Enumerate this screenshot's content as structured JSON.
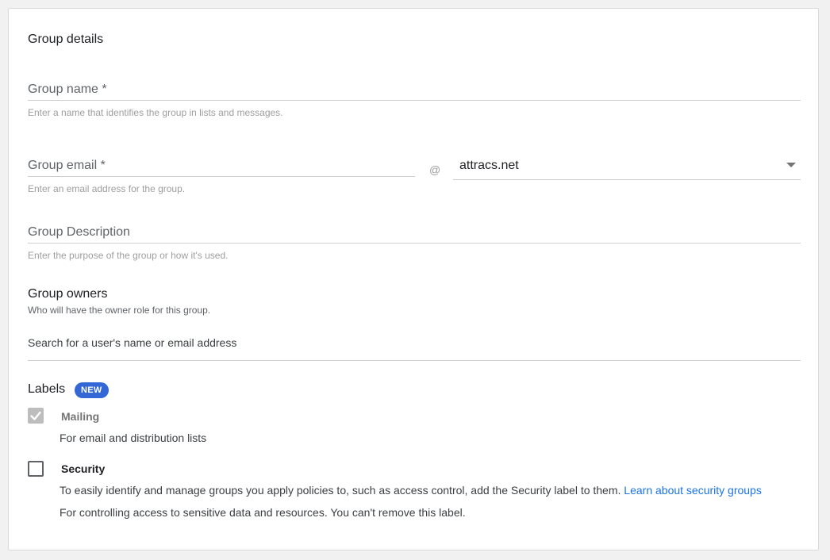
{
  "section": {
    "title": "Group details"
  },
  "group_name": {
    "label": "Group name *",
    "hint": "Enter a name that identifies the group in lists and messages."
  },
  "group_email": {
    "label": "Group email *",
    "at": "@",
    "domain": "attracs.net",
    "hint": "Enter an email address for the group."
  },
  "group_description": {
    "label": "Group Description",
    "hint": "Enter the purpose of the group or how it's used."
  },
  "owners": {
    "title": "Group owners",
    "subtitle": "Who will have the owner role for this group.",
    "search_placeholder": "Search for a user's name or email address"
  },
  "labels": {
    "title": "Labels",
    "badge": "NEW",
    "mailing": {
      "name": "Mailing",
      "description": "For email and distribution lists",
      "checked": true
    },
    "security": {
      "name": "Security",
      "info": "To easily identify and manage groups you apply policies to, such as access control, add the Security label to them.",
      "link": "Learn about security groups",
      "description": "For controlling access to sensitive data and resources. You can't remove this label.",
      "checked": false
    }
  },
  "colors": {
    "accent": "#3367d6",
    "link": "#1a73e8"
  }
}
